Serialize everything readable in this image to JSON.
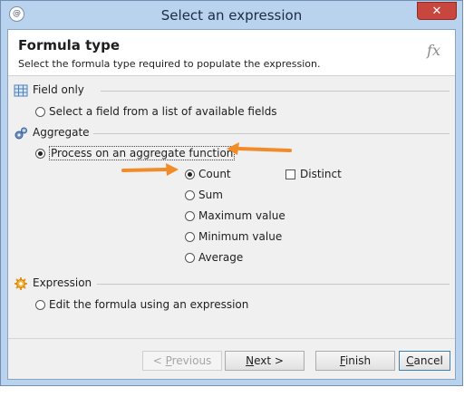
{
  "window": {
    "title": "Select an expression",
    "close_label": "✕",
    "app_icon_glyph": "@"
  },
  "header": {
    "title": "Formula type",
    "description": "Select the formula type required to populate the expression.",
    "fx_label": "fx"
  },
  "sections": {
    "field_only": {
      "label": "Field only",
      "icon": "table-grid-icon",
      "option": "Select a field from a list of available fields",
      "selected": false
    },
    "aggregate": {
      "label": "Aggregate",
      "icon": "gears-icon",
      "option": "Process on an aggregate function",
      "selected": true,
      "functions": [
        {
          "label": "Count",
          "selected": true
        },
        {
          "label": "Sum",
          "selected": false
        },
        {
          "label": "Maximum value",
          "selected": false
        },
        {
          "label": "Minimum value",
          "selected": false
        },
        {
          "label": "Average",
          "selected": false
        }
      ],
      "distinct_label": "Distinct",
      "distinct_checked": false
    },
    "expression": {
      "label": "Expression",
      "icon": "sun-gear-icon",
      "option": "Edit the formula using an expression",
      "selected": false
    }
  },
  "buttons": {
    "previous": {
      "prefix": "< ",
      "key": "P",
      "rest": "revious",
      "enabled": false
    },
    "next": {
      "key": "N",
      "rest": "ext >",
      "enabled": true
    },
    "finish": {
      "key": "F",
      "rest": "inish",
      "enabled": true
    },
    "cancel": {
      "prefix": "",
      "key": "C",
      "rest": "ancel",
      "enabled": true
    }
  },
  "colors": {
    "accent_arrow": "#f08c2a",
    "window_frame": "#b9d3ee",
    "close_button": "#c7463e"
  }
}
